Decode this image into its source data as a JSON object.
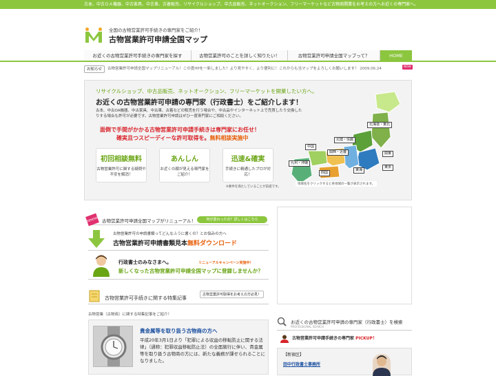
{
  "topbar": {
    "text": "古本、中古ＯＡ機器、中古家具、中古車、古着販売、リサイクルショップ、中古品販売、ネットオークション、フリーマーケットなど古物商開業をお考えの方へお近くの専門家へ。"
  },
  "logo": {
    "tagline": "全国の古物営業許可手続きの専門家をご紹介！",
    "title": "古物営業許可申請全国マップ"
  },
  "nav": [
    {
      "label": "お近くの古物営業許可手続きの専門家を探す"
    },
    {
      "label": "古物営業許可のことを詳しく知りたい！"
    },
    {
      "label": "古物営業許可申請全国マップって？"
    },
    {
      "label": "HOME"
    }
  ],
  "news": {
    "tag": "お知らせ",
    "text": "古物営業許可申請全国マップリニューアル！この度HPを一新しました！より見やすく、より便利に！これからも当マップをよろしくお願いします！ 2009.06.24",
    "badge": "NEW"
  },
  "hero": {
    "sub": "リサイクルショップ、中古品販売、ネットオークション、フリーマーケットを開業したい方へ。",
    "title": "お近くの古物営業許可申請の専門家（行政書士）をご紹介します！",
    "desc": "古本、中古OA機器、中古家具、中古車、古着などの販売を行う場合や、中古品やインターネット上で売買したり交換したりする場合も許可が必要です。古物営業許可申請はぜひ一度専門家にご相談ください。",
    "red1": "面倒で手間がかかる古物営業許可申請手続きは専門家にお任せ！",
    "red2_a": "確実且つスピーディーな許可取得を。",
    "red2_b": "無料相談実施中",
    "features": [
      {
        "title": "初回相談無料",
        "desc": "古物営業許可に関する疑問や不安を解消！"
      },
      {
        "title": "あんしん",
        "desc": "お近くの顔が見える専門家をご紹介！"
      },
      {
        "title": "迅速&確実",
        "desc": "手続きに精通したプロが対応！"
      }
    ],
    "feat_note": "※要件を満たしていることが前提です。",
    "map_labels": {
      "hokkaido": "北海道・東北",
      "hokuriku": "北陸・信越",
      "kanto": "関東",
      "tokyo": "東京",
      "tokai": "東海",
      "kansai": "関西・近畿",
      "chugoku": "中国",
      "shikoku": "四国",
      "kyushu": "九州・沖縄"
    },
    "map_note": "地域名をクリックすると各地域の一覧が表示されます。"
  },
  "banners": {
    "renewal_badge": "RENEWAL",
    "renewal_text": "古物営業許可申請全国マップがリニューアル！",
    "renewal_btn": "何が変わったの？詳しくはこちら",
    "download_small": "古物営業許可の申請書類ってどんなふうに書くの？とお悩みの方へ",
    "download_title_a": "古物営業許可申請書類見本",
    "download_title_b": "無料ダウンロード",
    "gyosei_name": "行政書士のみなさまへ。",
    "campaign": "リニューアルキャンペーン実施中！",
    "gyosei_title": "新しくなった古物営業許可申請全国マップに登録しませんか？"
  },
  "section": {
    "title": "古物営業許可手続きに関する特集記事",
    "tag": "古物営業許可取得をお考えの方必見！",
    "sub": "古物営業（古物商）に関する特集記事をご紹介！"
  },
  "article": {
    "title": "貴金属等を取り扱う古物商の方へ",
    "body": "平成20年3月1日より「犯罪による収益の移転防止に関する法律」（通称：犯罪収益移転防止法）の全面施行に伴い、貴金属等を取り扱う古物商の方には、新たな義務が課せられることになりました。"
  },
  "right": {
    "head_title": "お近くの古物営業許可申請の専門家（行政書士）を検索",
    "head_sub": "PROFESSIONAL SEARCH",
    "pickup_text": "古物営業許可申請手続きの専門家",
    "pickup_hl": "PICKUP！",
    "office_area": "【新宿区】",
    "office_name": "田中行政書士事務所"
  },
  "colors": {
    "accent": "#8cc63f",
    "red": "#d8232a",
    "orange": "#e8600c",
    "link": "#1a4fa0"
  }
}
